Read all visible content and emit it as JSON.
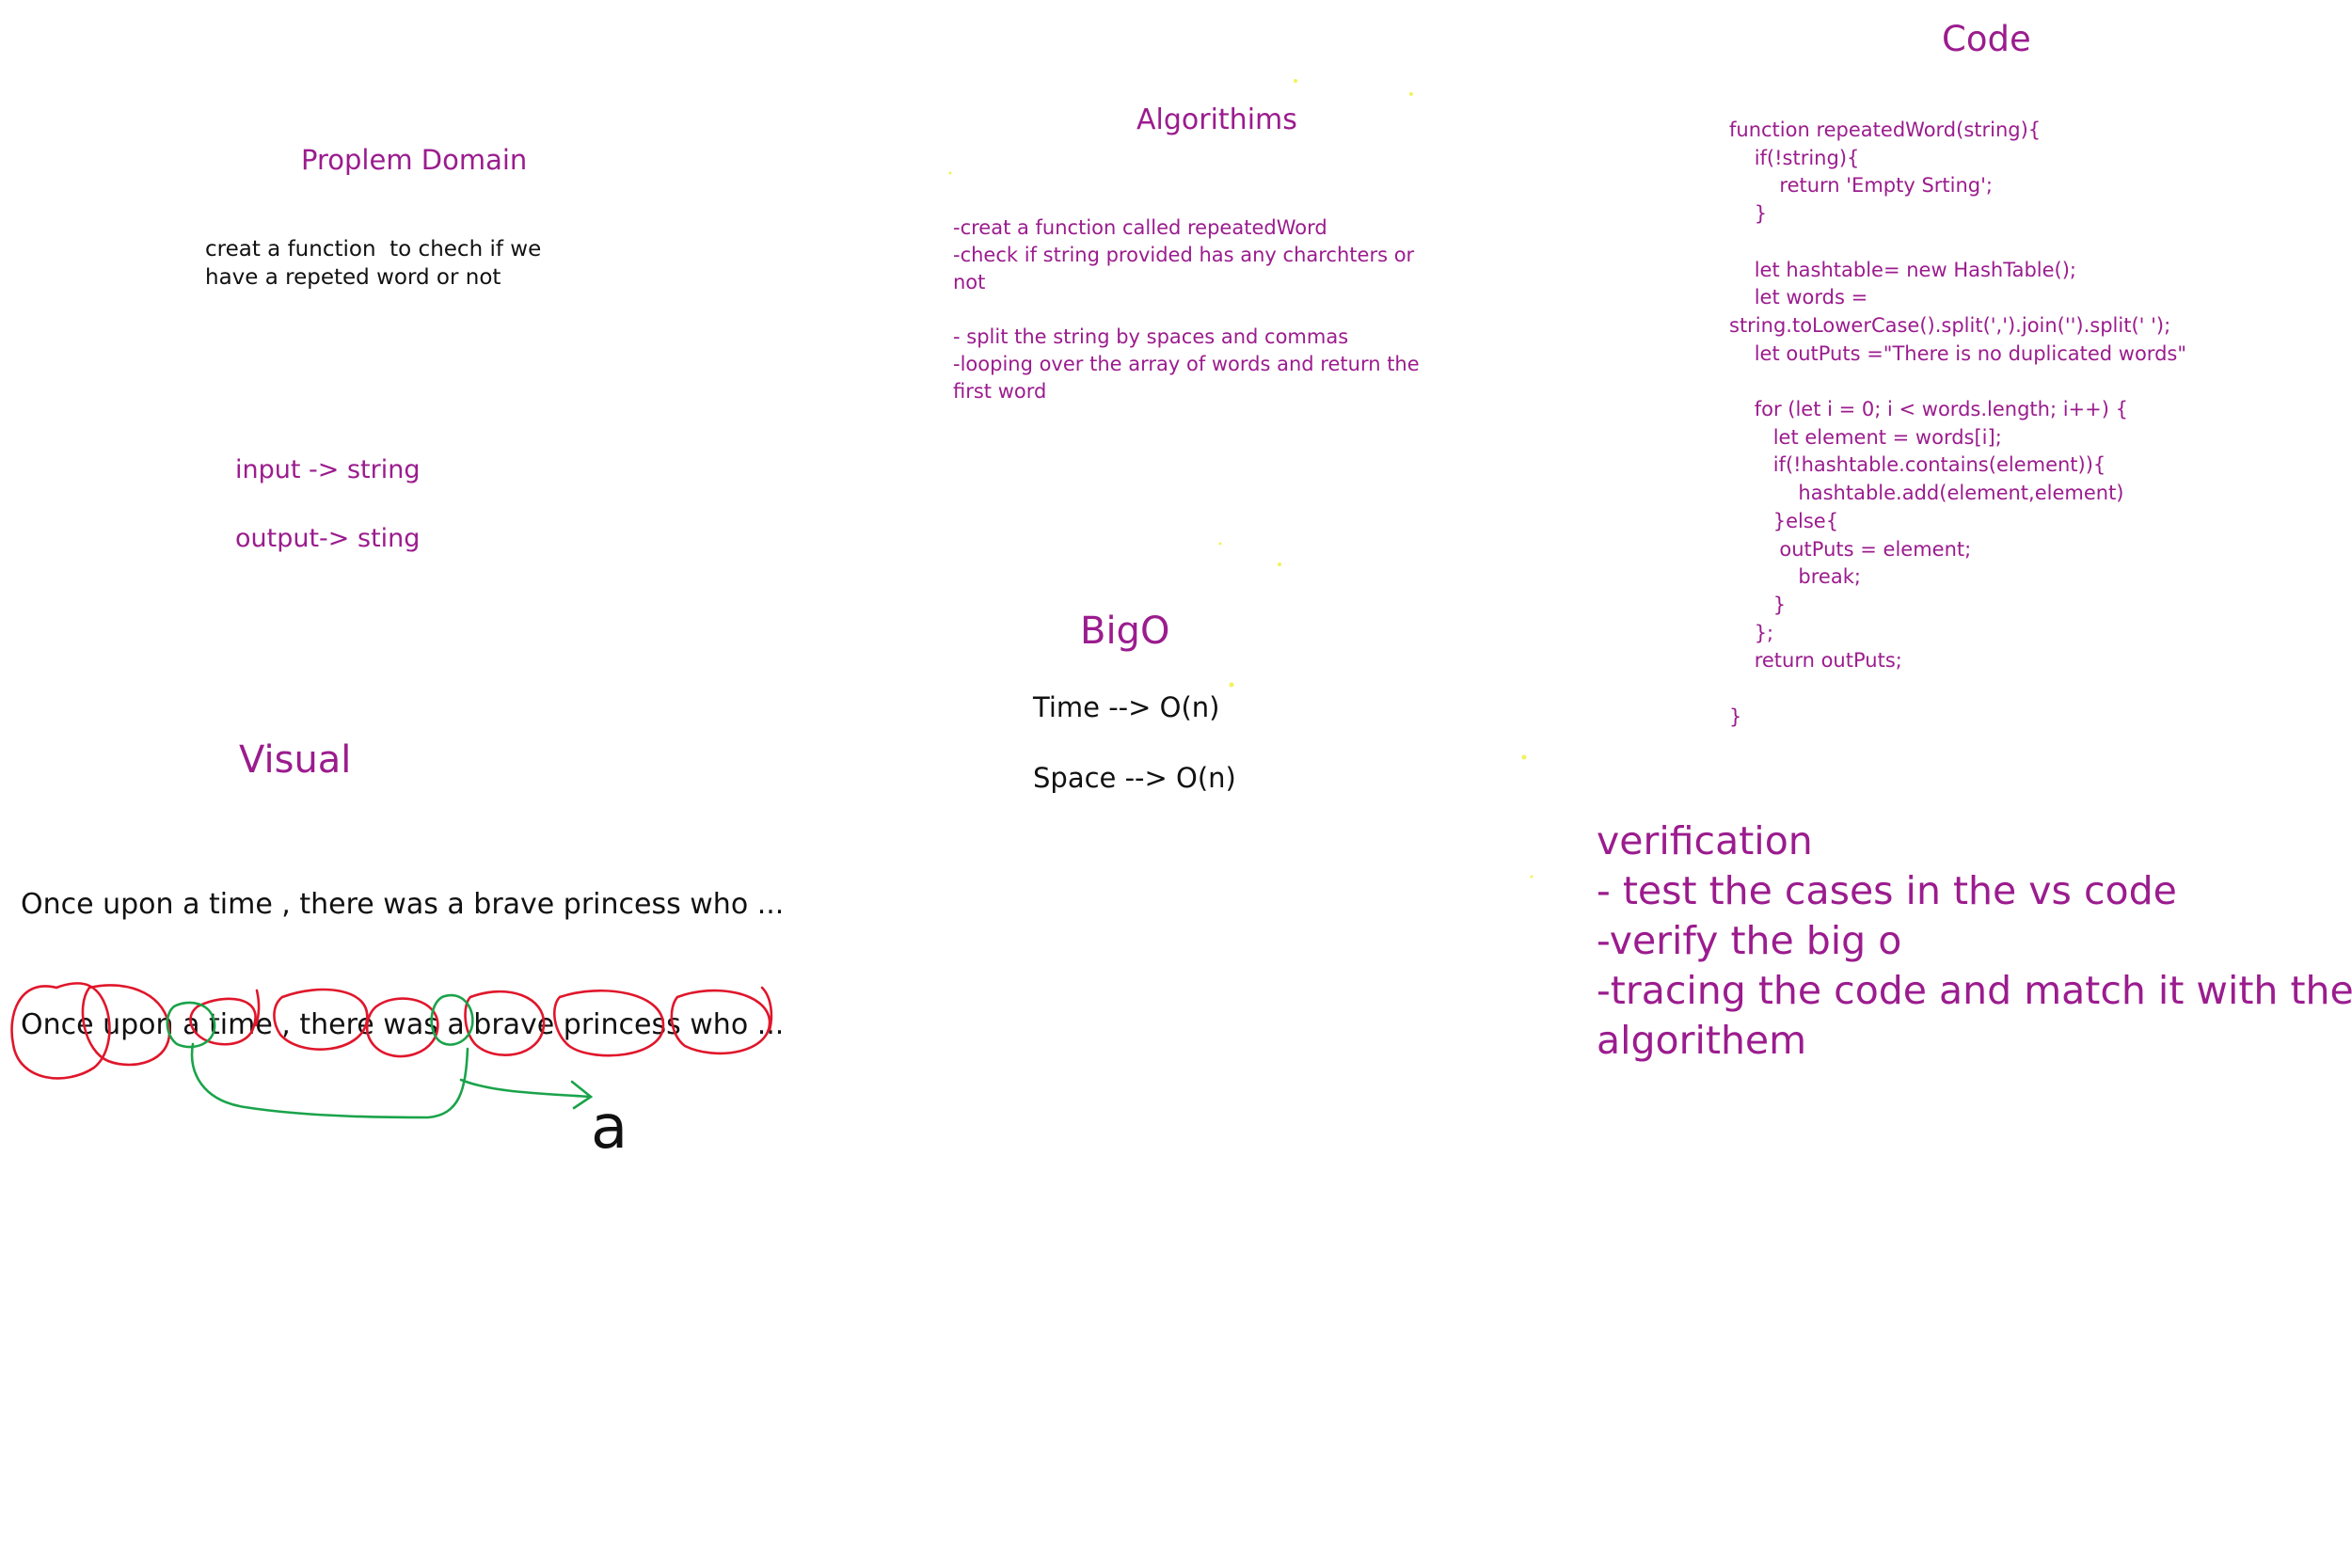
{
  "problem_domain": {
    "title": "Proplem Domain",
    "description_lines": [
      "creat a function  to chech if we",
      "have a repeted word or not"
    ],
    "input": "input -> string",
    "output": "output-> sting"
  },
  "algorithms": {
    "title": "Algorithims",
    "lines": [
      "-creat a function called repeatedWord",
      "-check if string provided has any charchters or",
      "not",
      "",
      "- split the string by spaces and commas",
      "-looping over the array of words and return the",
      "first word"
    ]
  },
  "code": {
    "title": "Code",
    "lines": [
      "function repeatedWord(string){",
      "    if(!string){",
      "        return 'Empty Srting';",
      "    }",
      "",
      "    let hashtable= new HashTable();",
      "    let words =",
      "string.toLowerCase().split(',').join('').split(' ');",
      "    let outPuts =\"There is no duplicated words\"",
      "",
      "    for (let i = 0; i < words.length; i++) {",
      "       let element = words[i];",
      "       if(!hashtable.contains(element)){",
      "           hashtable.add(element,element)",
      "       }else{",
      "        outPuts = element;",
      "           break;",
      "       }",
      "    };",
      "    return outPuts;",
      "",
      "}"
    ]
  },
  "big_o": {
    "title": "BigO",
    "time": "Time --> O(n)",
    "space": "Space --> O(n)"
  },
  "visual": {
    "title": "Visual",
    "sentence_1": "Once upon a time , there was a brave princess who ...",
    "sentence_2": "Once upon a time , there was a brave princess who ...",
    "result": "a"
  },
  "verification": {
    "lines": [
      "verification",
      "- test the cases in the vs code",
      "-verify the big o",
      "-tracing the code and match it with the",
      "algorithem"
    ]
  },
  "colors": {
    "ink_purple": "#9b1c8e",
    "ink_black": "#111111",
    "circle_red": "#e0162b",
    "arrow_green": "#1aa34a",
    "speck_yellow": "#f2f25a"
  }
}
